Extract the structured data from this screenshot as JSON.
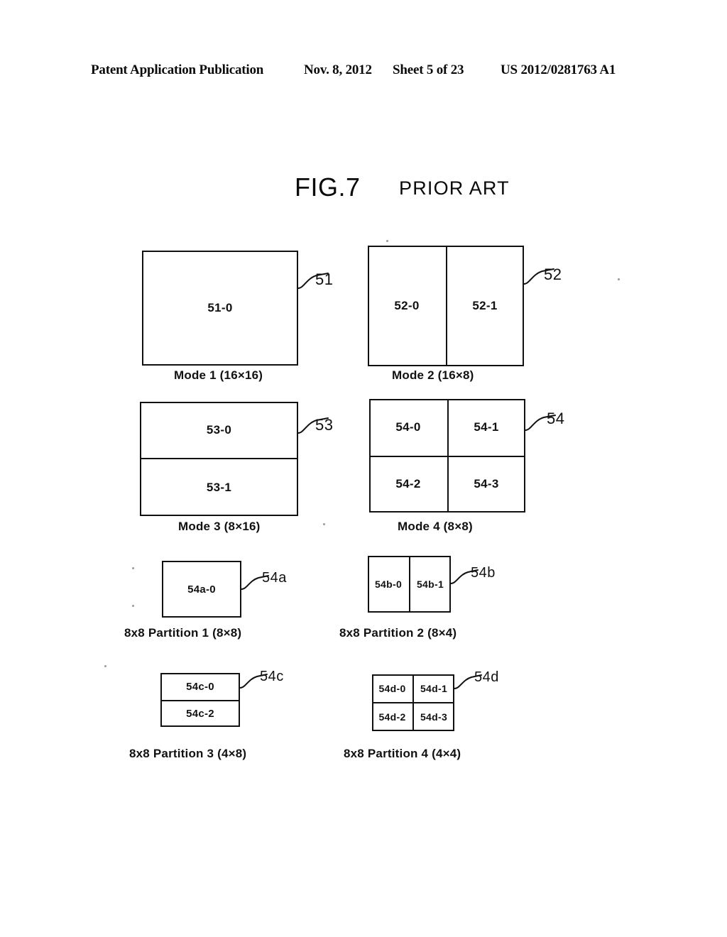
{
  "header": {
    "publication": "Patent Application Publication",
    "date": "Nov. 8, 2012",
    "sheet": "Sheet 5 of 23",
    "patent_number": "US 2012/0281763 A1"
  },
  "figure": {
    "title": "FIG.7",
    "note": "PRIOR ART"
  },
  "blocks": [
    {
      "id": "mode1",
      "ref": "51",
      "caption": "Mode 1 (16×16)",
      "partitions": [
        "51-0"
      ]
    },
    {
      "id": "mode2",
      "ref": "52",
      "caption": "Mode 2 (16×8)",
      "partitions": [
        "52-0",
        "52-1"
      ]
    },
    {
      "id": "mode3",
      "ref": "53",
      "caption": "Mode 3 (8×16)",
      "partitions": [
        "53-0",
        "53-1"
      ]
    },
    {
      "id": "mode4",
      "ref": "54",
      "caption": "Mode 4 (8×8)",
      "partitions": [
        "54-0",
        "54-1",
        "54-2",
        "54-3"
      ]
    },
    {
      "id": "partition1",
      "ref": "54a",
      "caption": "8x8 Partition 1 (8×8)",
      "partitions": [
        "54a-0"
      ]
    },
    {
      "id": "partition2",
      "ref": "54b",
      "caption": "8x8 Partition 2 (8×4)",
      "partitions": [
        "54b-0",
        "54b-1"
      ]
    },
    {
      "id": "partition3",
      "ref": "54c",
      "caption": "8x8 Partition 3 (4×8)",
      "partitions": [
        "54c-0",
        "54c-2"
      ]
    },
    {
      "id": "partition4",
      "ref": "54d",
      "caption": "8x8 Partition 4 (4×4)",
      "partitions": [
        "54d-0",
        "54d-1",
        "54d-2",
        "54d-3"
      ]
    }
  ]
}
